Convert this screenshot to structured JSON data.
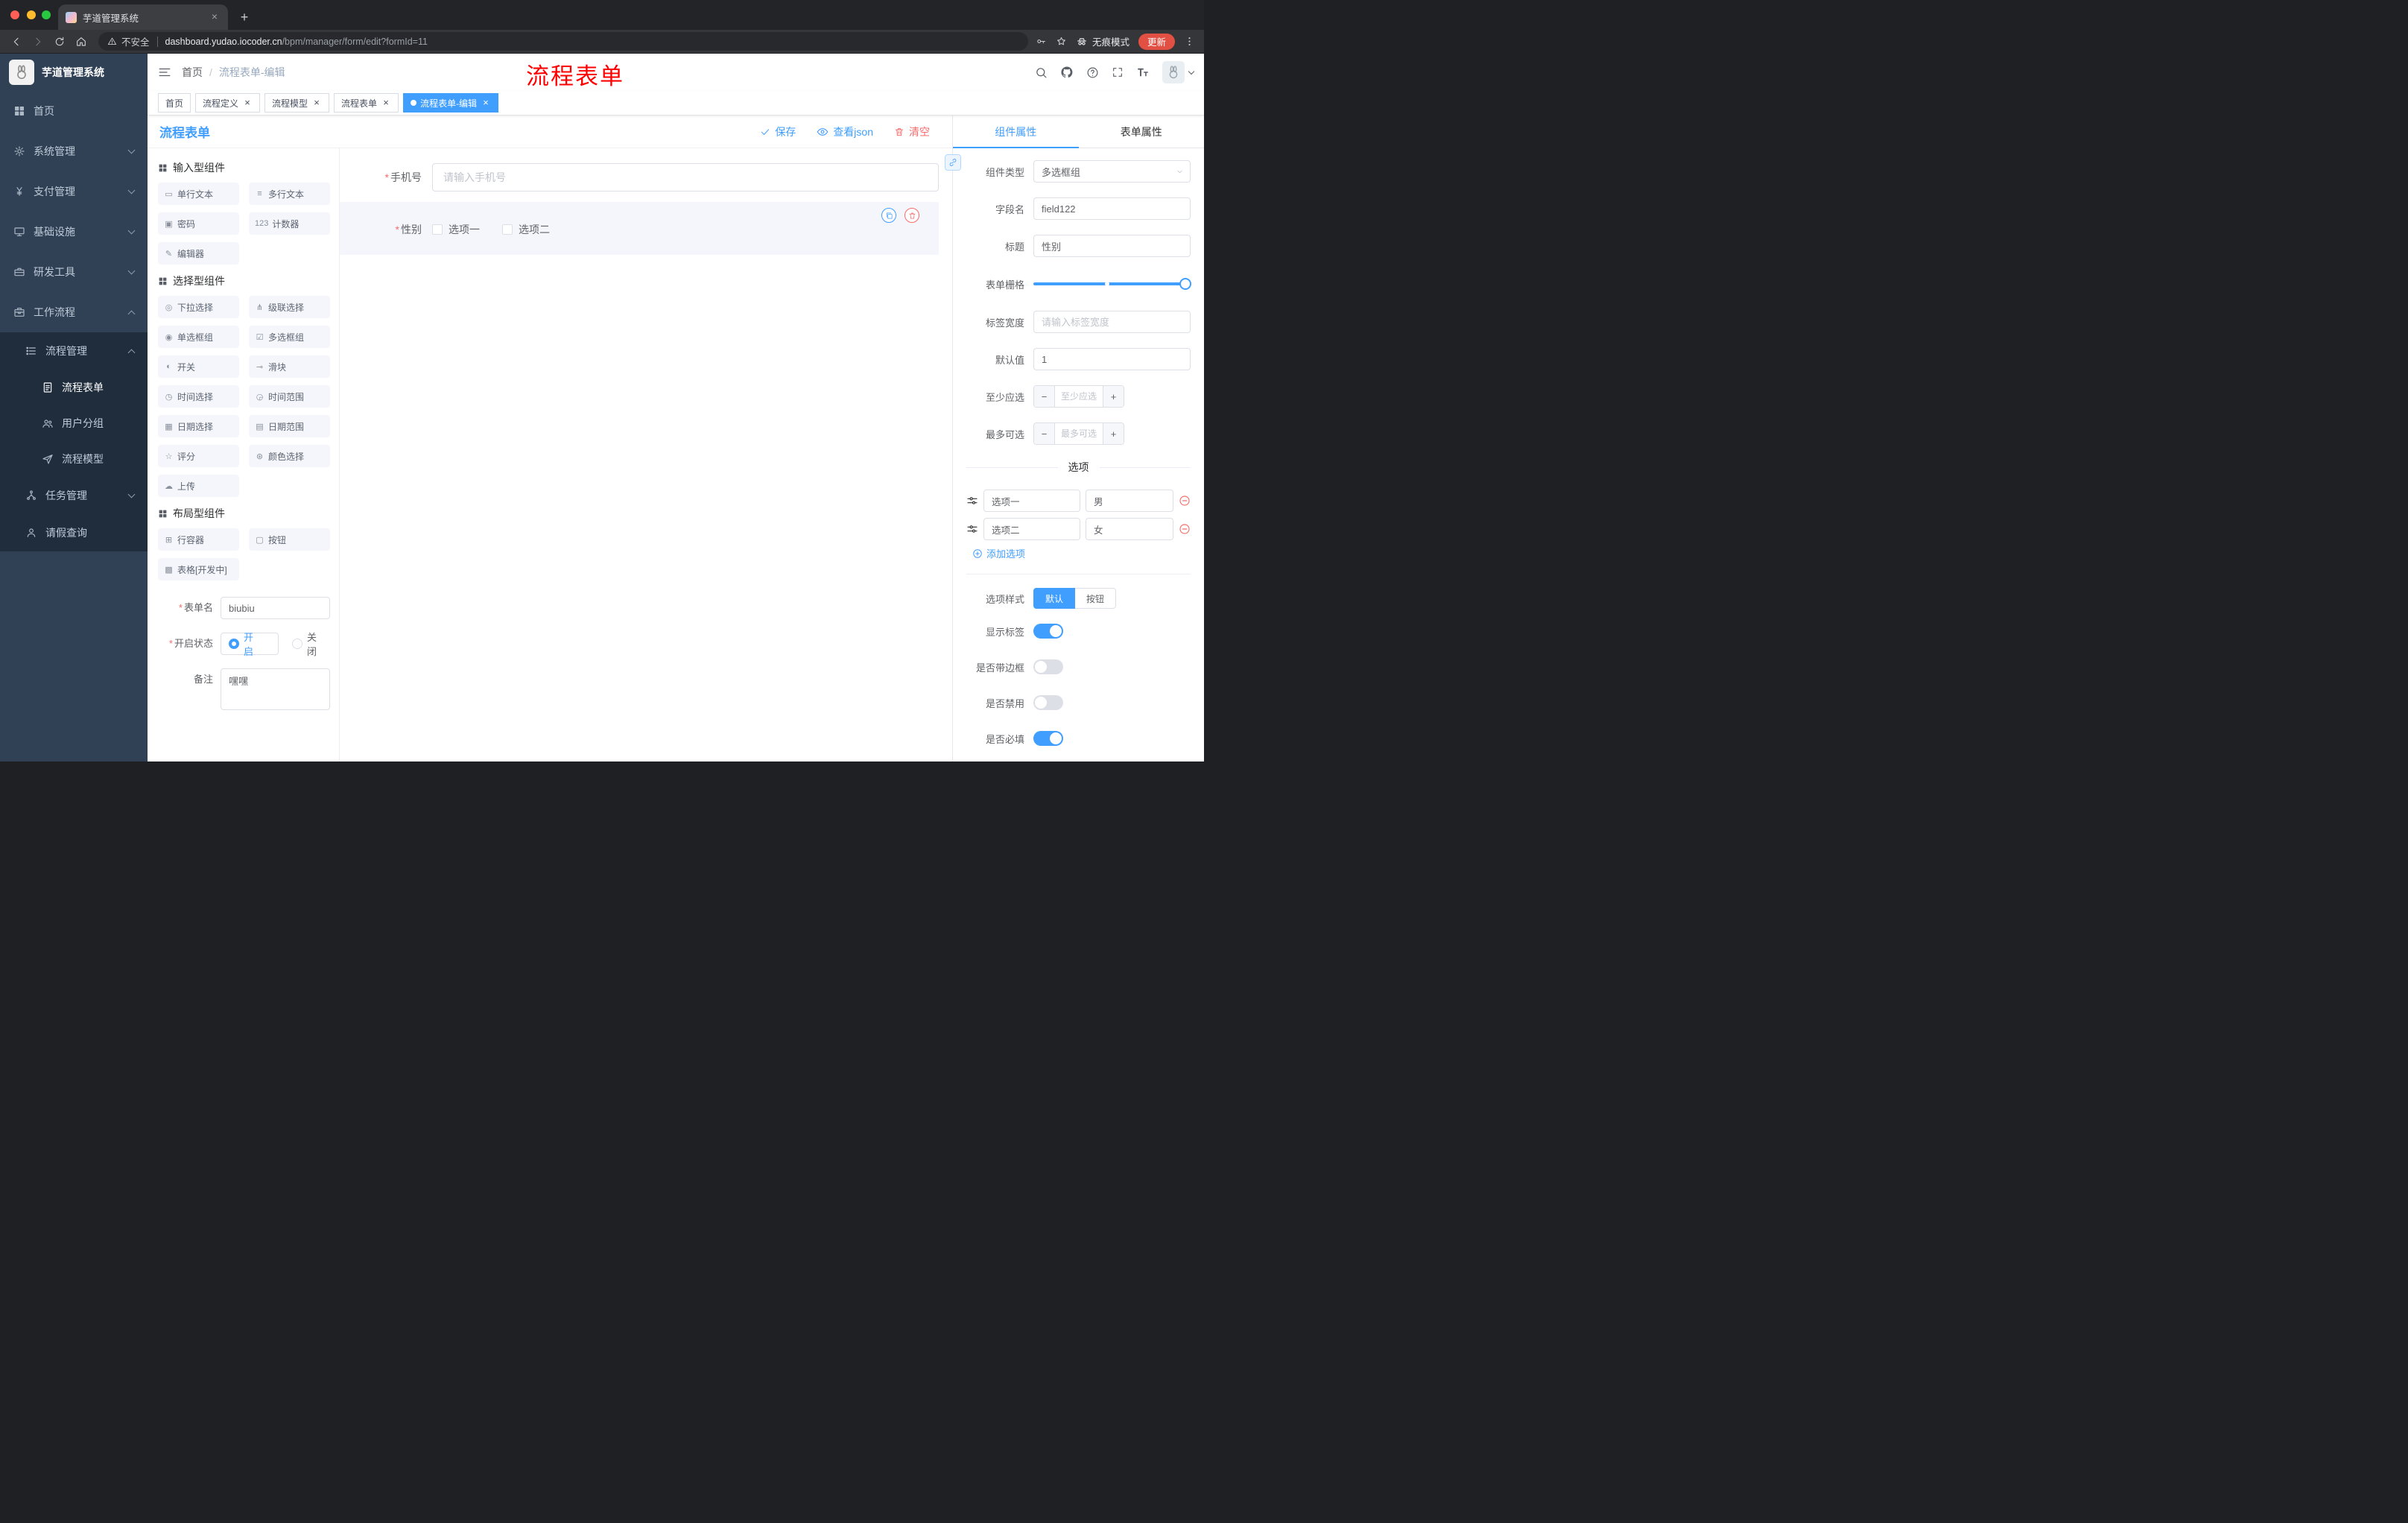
{
  "colors": {
    "primary": "#409eff",
    "danger": "#f56c6c",
    "sidebar_bg": "#304156",
    "sidebar_sub_bg": "#1f2d3d",
    "annotation_red": "#fe0000"
  },
  "browser": {
    "tab_title": "芋道管理系统",
    "security_label": "不安全",
    "url_domain": "dashboard.yudao.iocoder.cn",
    "url_path": "/bpm/manager/form/edit?formId=11",
    "incognito_label": "无痕模式",
    "update_label": "更新"
  },
  "sidebar": {
    "logo_title": "芋道管理系统",
    "items": [
      {
        "label": "首页"
      },
      {
        "label": "系统管理"
      },
      {
        "label": "支付管理"
      },
      {
        "label": "基础设施"
      },
      {
        "label": "研发工具"
      },
      {
        "label": "工作流程"
      },
      {
        "label": "流程管理"
      },
      {
        "label": "流程表单"
      },
      {
        "label": "用户分组"
      },
      {
        "label": "流程模型"
      },
      {
        "label": "任务管理"
      },
      {
        "label": "请假查询"
      }
    ]
  },
  "header": {
    "breadcrumb_home": "首页",
    "breadcrumb_sep": "/",
    "breadcrumb_current": "流程表单-编辑",
    "annotation": "流程表单"
  },
  "tags": [
    {
      "label": "首页"
    },
    {
      "label": "流程定义"
    },
    {
      "label": "流程模型"
    },
    {
      "label": "流程表单"
    },
    {
      "label": "流程表单-编辑"
    }
  ],
  "designer": {
    "title": "流程表单",
    "save": "保存",
    "view_json": "查看json",
    "clear": "清空"
  },
  "palette": {
    "groups": [
      {
        "title": "输入型组件",
        "items": [
          {
            "label": "单行文本",
            "glyph": "▭"
          },
          {
            "label": "多行文本",
            "glyph": "≡"
          },
          {
            "label": "密码",
            "glyph": "▣"
          },
          {
            "label": "计数器",
            "glyph": "123"
          },
          {
            "label": "编辑器",
            "glyph": "✎"
          }
        ]
      },
      {
        "title": "选择型组件",
        "items": [
          {
            "label": "下拉选择",
            "glyph": "◎"
          },
          {
            "label": "级联选择",
            "glyph": "⋔"
          },
          {
            "label": "单选框组",
            "glyph": "◉"
          },
          {
            "label": "多选框组",
            "glyph": "☑"
          },
          {
            "label": "开关",
            "glyph": "◐"
          },
          {
            "label": "滑块",
            "glyph": "⊸"
          },
          {
            "label": "时间选择",
            "glyph": "◷"
          },
          {
            "label": "时间范围",
            "glyph": "◶"
          },
          {
            "label": "日期选择",
            "glyph": "▦"
          },
          {
            "label": "日期范围",
            "glyph": "▤"
          },
          {
            "label": "评分",
            "glyph": "☆"
          },
          {
            "label": "颜色选择",
            "glyph": "⊛"
          },
          {
            "label": "上传",
            "glyph": "☁"
          }
        ]
      },
      {
        "title": "布局型组件",
        "items": [
          {
            "label": "行容器",
            "glyph": "⊞"
          },
          {
            "label": "按钮",
            "glyph": "▢"
          },
          {
            "label": "表格[开发中]",
            "glyph": "▩"
          }
        ]
      }
    ],
    "form": {
      "name_label": "表单名",
      "name_value": "biubiu",
      "status_label": "开启状态",
      "status_on": "开启",
      "status_off": "关闭",
      "remark_label": "备注",
      "remark_value": "嘿嘿"
    }
  },
  "canvas": {
    "phone_label": "手机号",
    "phone_placeholder": "请输入手机号",
    "gender_label": "性别",
    "gender_options": [
      {
        "label": "选项一"
      },
      {
        "label": "选项二"
      }
    ]
  },
  "props": {
    "tab_component": "组件属性",
    "tab_form": "表单属性",
    "type_label": "组件类型",
    "type_value": "多选框组",
    "field_label": "字段名",
    "field_value": "field122",
    "title_label": "标题",
    "title_value": "性别",
    "grid_label": "表单栅格",
    "label_width_label": "标签宽度",
    "label_width_placeholder": "请输入标签宽度",
    "default_label": "默认值",
    "default_value": "1",
    "min_label": "至少应选",
    "min_placeholder": "至少应选",
    "max_label": "最多可选",
    "max_placeholder": "最多可选",
    "options_title": "选项",
    "options": [
      {
        "label": "选项一",
        "value": "男"
      },
      {
        "label": "选项二",
        "value": "女"
      }
    ],
    "add_option": "添加选项",
    "style_label": "选项样式",
    "style_default": "默认",
    "style_button": "按钮",
    "switch_show_label": "显示标签",
    "switch_border": "是否带边框",
    "switch_disabled": "是否禁用",
    "switch_required": "是否必填"
  },
  "icons": {
    "close": "×",
    "plus": "+",
    "minus": "−",
    "required": "*"
  }
}
